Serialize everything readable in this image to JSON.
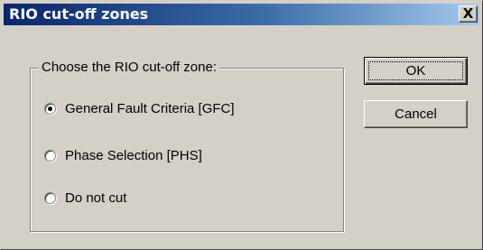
{
  "window": {
    "title": "RIO cut-off zones",
    "close_label": "X"
  },
  "group": {
    "legend": "Choose the RIO cut-off zone:",
    "options": [
      {
        "label": "General Fault Criteria [GFC]",
        "checked": true
      },
      {
        "label": "Phase Selection [PHS]",
        "checked": false
      },
      {
        "label": "Do not cut",
        "checked": false
      }
    ]
  },
  "buttons": {
    "ok_label": "OK",
    "cancel_label": "Cancel"
  },
  "colors": {
    "face": "#d4d0c8",
    "title_start": "#0a246a",
    "title_end": "#a6caf0"
  }
}
